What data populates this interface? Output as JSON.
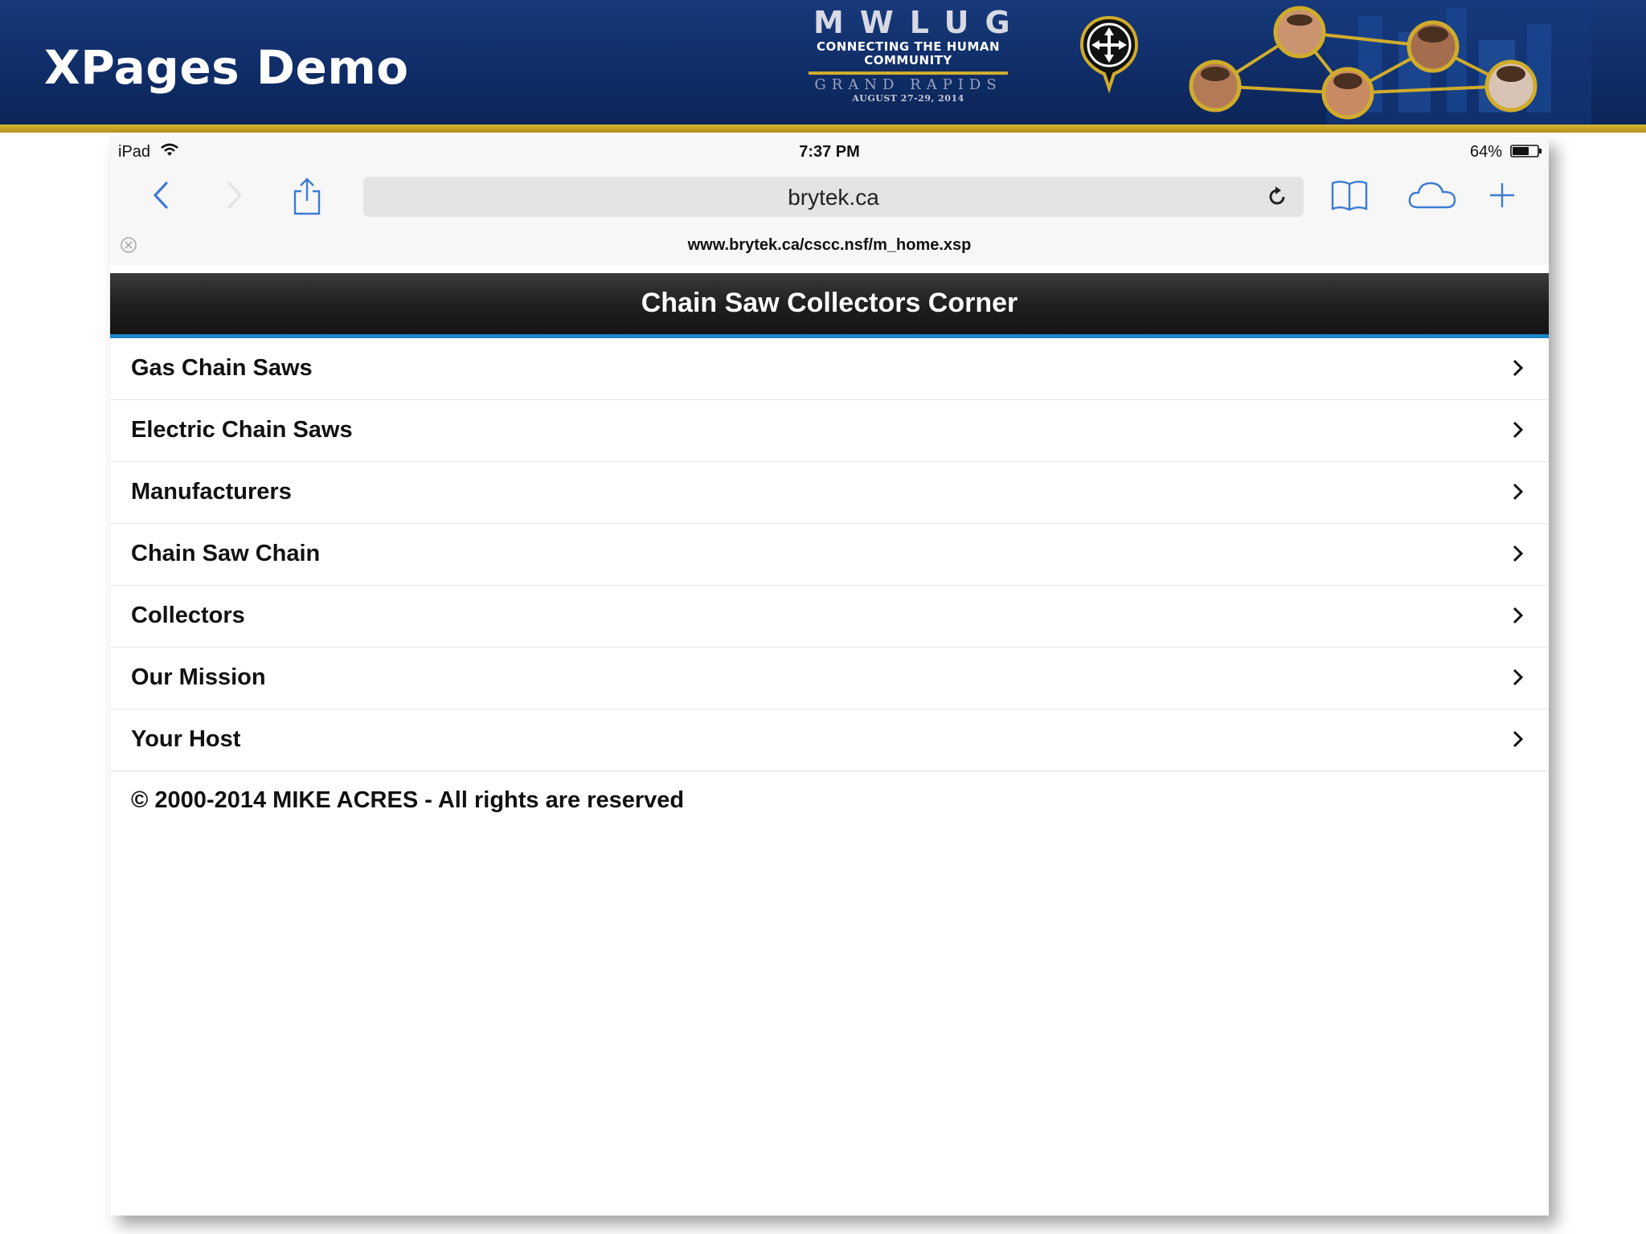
{
  "slide": {
    "title": "XPages Demo"
  },
  "logo": {
    "letters": "MWLUG",
    "tagline_1": "CONNECTING THE HUMAN",
    "tagline_2": "COMMUNITY",
    "city": "GRAND RAPIDS",
    "dates": "AUGUST 27-29, 2014"
  },
  "status_bar": {
    "device": "iPad",
    "time": "7:37 PM",
    "battery": "64%"
  },
  "toolbar": {
    "address": "brytek.ca"
  },
  "url_bar": {
    "url": "www.brytek.ca/cscc.nsf/m_home.xsp"
  },
  "page": {
    "header_title": "Chain Saw Collectors Corner",
    "menu": [
      {
        "label": "Gas Chain Saws"
      },
      {
        "label": "Electric Chain Saws"
      },
      {
        "label": "Manufacturers"
      },
      {
        "label": "Chain Saw Chain"
      },
      {
        "label": "Collectors"
      },
      {
        "label": "Our Mission"
      },
      {
        "label": "Your Host"
      }
    ],
    "footer": "© 2000-2014 MIKE ACRES - All rights are reserved"
  },
  "colors": {
    "banner": "#0f2c66",
    "banner_rule": "#d0ac2b",
    "header_accent": "#1a86c8",
    "ios_blue": "#3b7bd4"
  }
}
